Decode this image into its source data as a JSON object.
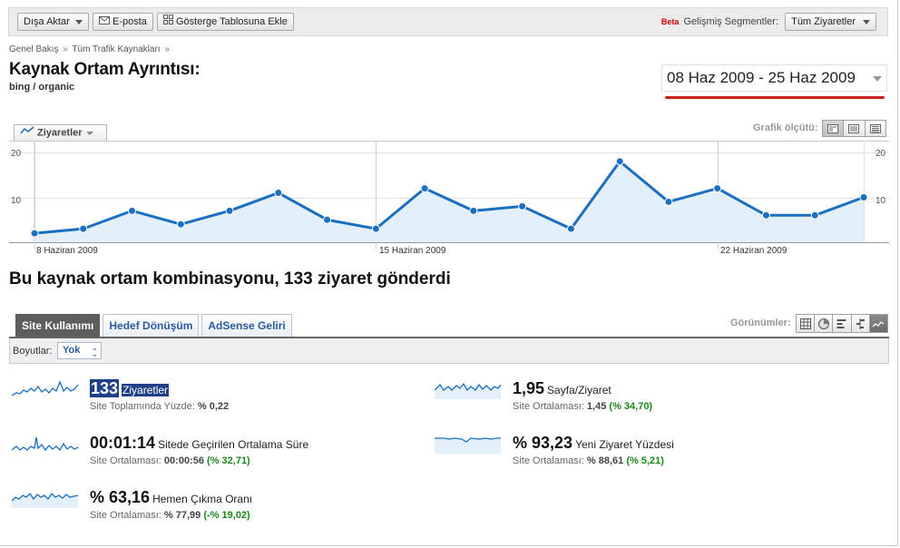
{
  "toolbar": {
    "export_label": "Dışa Aktar",
    "email_label": "E-posta",
    "dashboard_label": "Gösterge Tablosuna Ekle",
    "beta_label": "Beta",
    "segments_label": "Gelişmiş Segmentler:",
    "segments_value": "Tüm Ziyaretler"
  },
  "breadcrumb": {
    "items": [
      "Genel Bakış",
      "Tüm Trafik Kaynakları"
    ],
    "separator": "»"
  },
  "page": {
    "title": "Kaynak Ortam Ayrıntısı:",
    "subtitle": "bing / organic"
  },
  "date_range": {
    "label": "08 Haz 2009 - 25 Haz 2009"
  },
  "graph": {
    "metric_selector": "Ziyaretler",
    "measure_label": "Grafik ölçütü:"
  },
  "chart_data": {
    "type": "area",
    "series": [
      {
        "name": "Ziyaretler",
        "values": [
          2,
          3,
          7,
          4,
          7,
          11,
          5,
          3,
          12,
          7,
          8,
          3,
          18,
          9,
          12,
          6,
          6,
          10
        ]
      }
    ],
    "x_ticks": [
      "8 Haziran 2009",
      "15 Haziran 2009",
      "22 Haziran 2009"
    ],
    "y_ticks": [
      10,
      20
    ],
    "ylim": [
      0,
      20
    ],
    "grid": true,
    "colors": {
      "line": "#1a6fc1",
      "fill": "#e3f0fa"
    }
  },
  "headline": "Bu kaynak ortam kombinasyonu, 133 ziyaret gönderdi",
  "tabs": [
    "Site Kullanımı",
    "Hedef Dönüşüm",
    "AdSense Geliri"
  ],
  "views_label": "Görünümler:",
  "dimensions": {
    "label": "Boyutlar:",
    "value": "Yok"
  },
  "metrics": {
    "visits": {
      "value": "133",
      "label": "Ziyaretler",
      "sub_prefix": "Site Toplamında Yüzde:",
      "sub_value": "% 0,22"
    },
    "pages_per_visit": {
      "value": "1,95",
      "label": "Sayfa/Ziyaret",
      "sub_prefix": "Site Ortalaması:",
      "sub_value": "1,45",
      "sub_delta": "(% 34,70)"
    },
    "avg_time": {
      "value": "00:01:14",
      "label": "Sitede Geçirilen Ortalama Süre",
      "sub_prefix": "Site Ortalaması:",
      "sub_value": "00:00:56",
      "sub_delta": "(% 32,71)"
    },
    "new_visits": {
      "value": "% 93,23",
      "label": "Yeni Ziyaret Yüzdesi",
      "sub_prefix": "Site Ortalaması:",
      "sub_value": "% 88,61",
      "sub_delta": "(% 5,21)"
    },
    "bounce": {
      "value": "% 63,16",
      "label": "Hemen Çıkma Oranı",
      "sub_prefix": "Site Ortalaması:",
      "sub_value": "% 77,99",
      "sub_delta": "(-% 19,02)"
    }
  },
  "colors": {
    "accent": "#1a6fc1",
    "tab_active_bg": "#5d5d5d",
    "link": "#2a5aa0",
    "positive": "#1a8a1a",
    "date_underline": "#cc1f1f"
  }
}
